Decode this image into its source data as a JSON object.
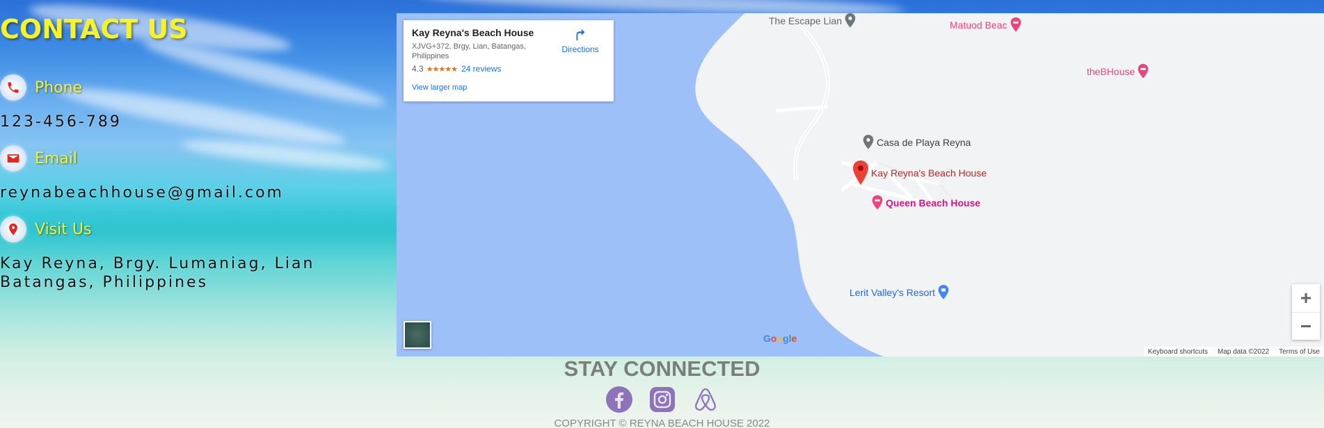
{
  "contact": {
    "title": "CONTACT US",
    "phone_label": "Phone",
    "phone_value": "123-456-789",
    "email_label": "Email",
    "email_value": "reynabeachhouse@gmail.com",
    "visit_label": "Visit Us",
    "address_line1": "Kay Reyna, Brgy. Lumaniag, Lian",
    "address_line2": "Batangas, Philippines"
  },
  "map": {
    "card": {
      "name": "Kay Reyna's Beach House",
      "address": "XJVG+372, Brgy, Lian, Batangas, Philippines",
      "rating": "4.3",
      "stars": "★★★★★",
      "reviews": "24 reviews",
      "directions": "Directions",
      "larger_map": "View larger map"
    },
    "places": {
      "escape": "The Escape Lian",
      "matuod": "Matuod Beac",
      "thebhouse": "theBHouse",
      "casa": "Casa de Playa Reyna",
      "kayreyna": "Kay Reyna's Beach House",
      "queen": "Queen Beach House",
      "lerit": "Lerit Valley's Resort"
    },
    "zoom_in": "+",
    "zoom_out": "−",
    "google_logo": "Google",
    "attribution": {
      "shortcuts": "Keyboard shortcuts",
      "data": "Map data ©2022",
      "terms": "Terms of Use"
    },
    "colors": {
      "water": "#9ec0f9",
      "land": "#f1f3f4",
      "pin": "#ea4335",
      "lodging": "#e8457c",
      "poi": "#1a73e8"
    }
  },
  "footer": {
    "title": "STAY CONNECTED",
    "copyright": "COPYRIGHT © REYNA BEACH HOUSE 2022",
    "social_icons": [
      "facebook-icon",
      "instagram-icon",
      "airbnb-icon"
    ]
  },
  "colors": {
    "accent_yellow": "#f7f32a",
    "icon_red": "#e8241a",
    "social_purple": "#8e73b8"
  }
}
